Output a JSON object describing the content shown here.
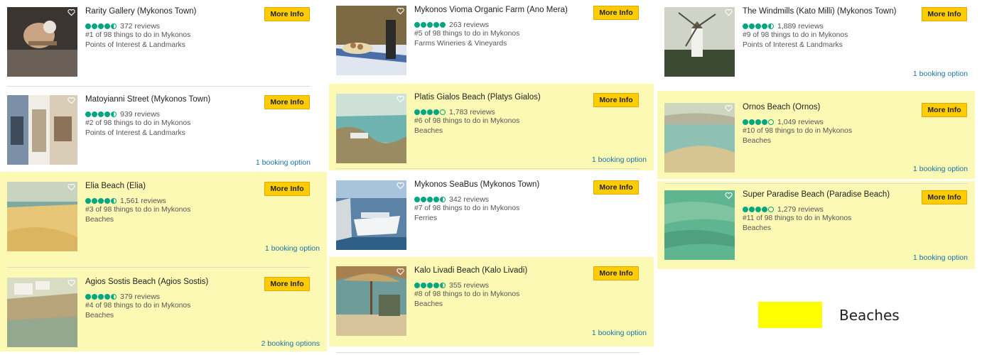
{
  "more_info_label": "More Info",
  "colors": {
    "highlight": "#fbf9b4",
    "legend": "#ffff00",
    "button": "#ffcc00",
    "rating": "#00a680",
    "link": "#1a73a8"
  },
  "legend": {
    "label": "Beaches"
  },
  "attractions": [
    {
      "name": "Rarity Gallery (Mykonos Town)",
      "rating": 4.5,
      "reviews": "372 reviews",
      "rank": "#1 of 98 things to do in Mykonos",
      "category": "Points of Interest & Landmarks",
      "booking": "",
      "highlighted": false,
      "image": "gallery-sculpture"
    },
    {
      "name": "Matoyianni Street (Mykonos Town)",
      "rating": 4.5,
      "reviews": "939 reviews",
      "rank": "#2 of 98 things to do in Mykonos",
      "category": "Points of Interest & Landmarks",
      "booking": "1 booking option",
      "highlighted": false,
      "image": "street-shops"
    },
    {
      "name": "Elia Beach (Elia)",
      "rating": 4.5,
      "reviews": "1,561 reviews",
      "rank": "#3 of 98 things to do in Mykonos",
      "category": "Beaches",
      "booking": "1 booking option",
      "highlighted": true,
      "image": "sandy-beach"
    },
    {
      "name": "Agios Sostis Beach (Agios Sostis)",
      "rating": 4.5,
      "reviews": "379 reviews",
      "rank": "#4 of 98 things to do in Mykonos",
      "category": "Beaches",
      "booking": "2 booking options",
      "highlighted": true,
      "image": "beach-houses"
    },
    {
      "name": "Mykonos Vioma Organic Farm (Ano Mera)",
      "rating": 5,
      "reviews": "263 reviews",
      "rank": "#5 of 98 things to do in Mykonos",
      "category": "Farms Wineries & Vineyards",
      "booking": "",
      "highlighted": false,
      "image": "wine-table"
    },
    {
      "name": "Platis Gialos Beach (Platys Gialos)",
      "rating": 4,
      "reviews": "1,783 reviews",
      "rank": "#6 of 98 things to do in Mykonos",
      "category": "Beaches",
      "booking": "1 booking option",
      "highlighted": true,
      "image": "bay-view"
    },
    {
      "name": "Mykonos SeaBus (Mykonos Town)",
      "rating": 4.5,
      "reviews": "342 reviews",
      "rank": "#7 of 98 things to do in Mykonos",
      "category": "Ferries",
      "booking": "",
      "highlighted": false,
      "image": "ferry-boat"
    },
    {
      "name": "Kalo Livadi Beach (Kalo Livadi)",
      "rating": 4.5,
      "reviews": "355 reviews",
      "rank": "#8 of 98 things to do in Mykonos",
      "category": "Beaches",
      "booking": "1 booking option",
      "highlighted": true,
      "image": "umbrella-beach"
    },
    {
      "name": "The Windmills (Kato Milli) (Mykonos Town)",
      "rating": 4.5,
      "reviews": "1,889 reviews",
      "rank": "#9 of 98 things to do in Mykonos",
      "category": "Points of Interest & Landmarks",
      "booking": "1 booking option",
      "highlighted": false,
      "image": "windmill"
    },
    {
      "name": "Ornos Beach (Ornos)",
      "rating": 4,
      "reviews": "1,049 reviews",
      "rank": "#10 of 98 things to do in Mykonos",
      "category": "Beaches",
      "booking": "1 booking option",
      "highlighted": true,
      "image": "cove-beach"
    },
    {
      "name": "Super Paradise Beach (Paradise Beach)",
      "rating": 4,
      "reviews": "1,279 reviews",
      "rank": "#11 of 98 things to do in Mykonos",
      "category": "Beaches",
      "booking": "1 booking option",
      "highlighted": true,
      "image": "green-water"
    }
  ]
}
